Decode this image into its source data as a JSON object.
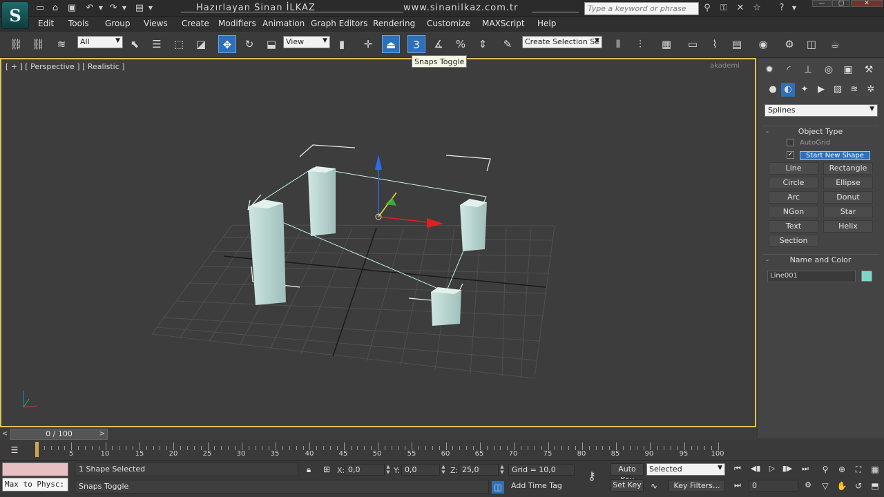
{
  "titlebar": {
    "author": "Hazırlayan Sinan İLKAZ",
    "website": "www.sinanilkaz.com.tr",
    "search_placeholder": "Type a keyword or phrase",
    "logo_letter": "S"
  },
  "menu": [
    "Edit",
    "Tools",
    "Group",
    "Views",
    "Create",
    "Modifiers",
    "Animation",
    "Graph Editors",
    "Rendering",
    "Customize",
    "MAXScript",
    "Help"
  ],
  "toolbar": {
    "selection_filter": "All",
    "ref_coord": "View",
    "named_selection": "Create Selection Se",
    "snap_label": "3",
    "tooltip": "Snaps Toggle"
  },
  "viewport": {
    "label": "[ + ] [ Perspective ] [ Realistic ]",
    "watermark": "akademi",
    "object_color": "#b9d6d2",
    "spline_color": "#c5f5ea"
  },
  "command_panel": {
    "category": "Splines",
    "object_type_title": "Object Type",
    "autogrid": "AutoGrid",
    "start_new_shape": "Start New Shape",
    "start_new_shape_checked": true,
    "buttons": [
      "Line",
      "Rectangle",
      "Circle",
      "Ellipse",
      "Arc",
      "Donut",
      "NGon",
      "Star",
      "Text",
      "Helix",
      "Section"
    ],
    "name_color_title": "Name and Color",
    "object_name": "Line001",
    "object_color": "#7fd6c8"
  },
  "timeline": {
    "frame_display": "0 / 100",
    "ticks": [
      "5",
      "10",
      "15",
      "20",
      "25",
      "30",
      "35",
      "40",
      "45",
      "50",
      "55",
      "60",
      "65",
      "70",
      "75",
      "80",
      "85",
      "90",
      "95",
      "100"
    ]
  },
  "status": {
    "maxscript_output": "Max to Physc:",
    "selection_info": "1 Shape Selected",
    "prompt": "Snaps Toggle",
    "x_label": "X:",
    "x_value": "0,0",
    "y_label": "Y:",
    "y_value": "0,0",
    "z_label": "Z:",
    "z_value": "25,0",
    "grid": "Grid = 10,0",
    "add_time_tag": "Add Time Tag",
    "auto_key": "Auto Key",
    "set_key": "Set Key",
    "key_mode": "Selected",
    "key_filters": "Key Filters...",
    "current_frame": "0"
  }
}
